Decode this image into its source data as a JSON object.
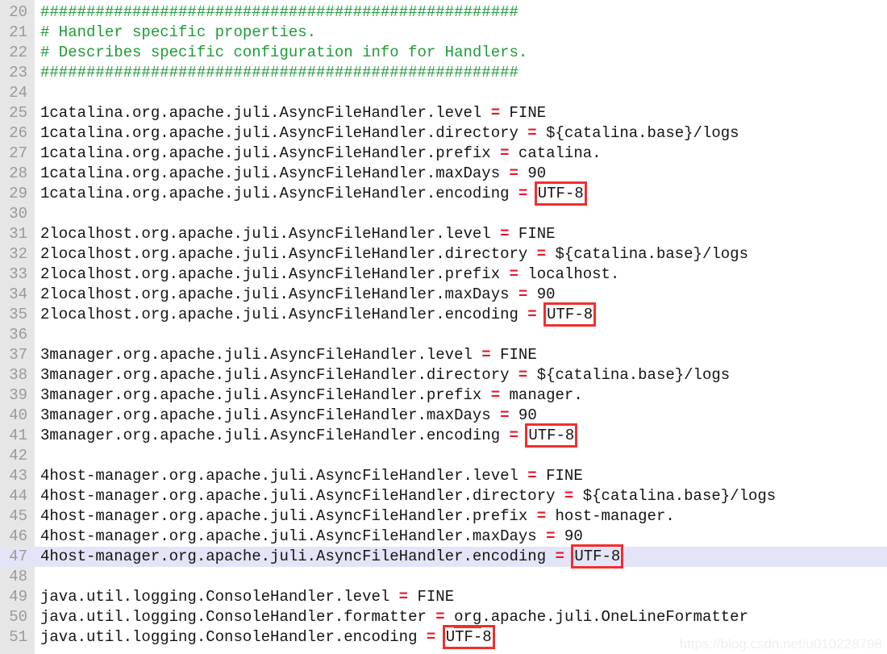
{
  "editor": {
    "type": "text-editor-code-view",
    "file_kind": "logging.properties",
    "colors": {
      "background": "#ffffff",
      "gutter": "#e6e6e6",
      "line_number": "#9a9a9a",
      "text": "#1a1a1a",
      "comment": "#1f9c38",
      "operator": "#e8152b",
      "annotation_box": "#f42d2d",
      "current_line_highlight": "#e4e4f8",
      "watermark": "#eceff1"
    },
    "current_line": 47,
    "first_visible_line": 20,
    "last_visible_line": 51
  },
  "watermark": {
    "text": "https://blog.csdn.net/u010228798"
  },
  "lines": [
    {
      "no": "20",
      "kind": "comment",
      "text": "####################################################"
    },
    {
      "no": "21",
      "kind": "comment",
      "text": "# Handler specific properties."
    },
    {
      "no": "22",
      "kind": "comment",
      "text": "# Describes specific configuration info for Handlers."
    },
    {
      "no": "23",
      "kind": "comment",
      "text": "####################################################"
    },
    {
      "no": "24",
      "kind": "blank",
      "text": ""
    },
    {
      "no": "25",
      "kind": "prop",
      "key": "1catalina.org.apache.juli.AsyncFileHandler.level",
      "op": " = ",
      "value": "FINE",
      "boxed": false
    },
    {
      "no": "26",
      "kind": "prop",
      "key": "1catalina.org.apache.juli.AsyncFileHandler.directory",
      "op": " = ",
      "value": "${catalina.base}/logs",
      "boxed": false
    },
    {
      "no": "27",
      "kind": "prop",
      "key": "1catalina.org.apache.juli.AsyncFileHandler.prefix",
      "op": " = ",
      "value": "catalina.",
      "boxed": false
    },
    {
      "no": "28",
      "kind": "prop",
      "key": "1catalina.org.apache.juli.AsyncFileHandler.maxDays",
      "op": " = ",
      "value": "90",
      "boxed": false
    },
    {
      "no": "29",
      "kind": "prop",
      "key": "1catalina.org.apache.juli.AsyncFileHandler.encoding",
      "op": " = ",
      "value": "UTF-8",
      "boxed": true
    },
    {
      "no": "30",
      "kind": "blank",
      "text": ""
    },
    {
      "no": "31",
      "kind": "prop",
      "key": "2localhost.org.apache.juli.AsyncFileHandler.level",
      "op": " = ",
      "value": "FINE",
      "boxed": false
    },
    {
      "no": "32",
      "kind": "prop",
      "key": "2localhost.org.apache.juli.AsyncFileHandler.directory",
      "op": " = ",
      "value": "${catalina.base}/logs",
      "boxed": false
    },
    {
      "no": "33",
      "kind": "prop",
      "key": "2localhost.org.apache.juli.AsyncFileHandler.prefix",
      "op": " = ",
      "value": "localhost.",
      "boxed": false
    },
    {
      "no": "34",
      "kind": "prop",
      "key": "2localhost.org.apache.juli.AsyncFileHandler.maxDays",
      "op": " = ",
      "value": "90",
      "boxed": false
    },
    {
      "no": "35",
      "kind": "prop",
      "key": "2localhost.org.apache.juli.AsyncFileHandler.encoding",
      "op": " = ",
      "value": "UTF-8",
      "boxed": true
    },
    {
      "no": "36",
      "kind": "blank",
      "text": ""
    },
    {
      "no": "37",
      "kind": "prop",
      "key": "3manager.org.apache.juli.AsyncFileHandler.level",
      "op": " = ",
      "value": "FINE",
      "boxed": false
    },
    {
      "no": "38",
      "kind": "prop",
      "key": "3manager.org.apache.juli.AsyncFileHandler.directory",
      "op": " = ",
      "value": "${catalina.base}/logs",
      "boxed": false
    },
    {
      "no": "39",
      "kind": "prop",
      "key": "3manager.org.apache.juli.AsyncFileHandler.prefix",
      "op": " = ",
      "value": "manager.",
      "boxed": false
    },
    {
      "no": "40",
      "kind": "prop",
      "key": "3manager.org.apache.juli.AsyncFileHandler.maxDays",
      "op": " = ",
      "value": "90",
      "boxed": false
    },
    {
      "no": "41",
      "kind": "prop",
      "key": "3manager.org.apache.juli.AsyncFileHandler.encoding",
      "op": " = ",
      "value": "UTF-8",
      "boxed": true
    },
    {
      "no": "42",
      "kind": "blank",
      "text": ""
    },
    {
      "no": "43",
      "kind": "prop",
      "key": "4host-manager.org.apache.juli.AsyncFileHandler.level",
      "op": " = ",
      "value": "FINE",
      "boxed": false
    },
    {
      "no": "44",
      "kind": "prop",
      "key": "4host-manager.org.apache.juli.AsyncFileHandler.directory",
      "op": " = ",
      "value": "${catalina.base}/logs",
      "boxed": false
    },
    {
      "no": "45",
      "kind": "prop",
      "key": "4host-manager.org.apache.juli.AsyncFileHandler.prefix",
      "op": " = ",
      "value": "host-manager.",
      "boxed": false
    },
    {
      "no": "46",
      "kind": "prop",
      "key": "4host-manager.org.apache.juli.AsyncFileHandler.maxDays",
      "op": " = ",
      "value": "90",
      "boxed": false
    },
    {
      "no": "47",
      "kind": "prop",
      "current": true,
      "key": "4host-manager.org.apache.juli.AsyncFileHandler.encoding",
      "op": " = ",
      "value": "UTF-8",
      "boxed": true
    },
    {
      "no": "48",
      "kind": "blank",
      "text": ""
    },
    {
      "no": "49",
      "kind": "prop",
      "key": "java.util.logging.ConsoleHandler.level",
      "op": " = ",
      "value": "FINE",
      "boxed": false
    },
    {
      "no": "50",
      "kind": "prop",
      "key": "java.util.logging.ConsoleHandler.formatter",
      "op": " = ",
      "value": "org.apache.juli.OneLineFormatter",
      "boxed": false,
      "underline_prefix": "org"
    },
    {
      "no": "51",
      "kind": "prop",
      "key": "java.util.logging.ConsoleHandler.encoding",
      "op": " = ",
      "value": "UTF-8",
      "boxed": true
    }
  ]
}
